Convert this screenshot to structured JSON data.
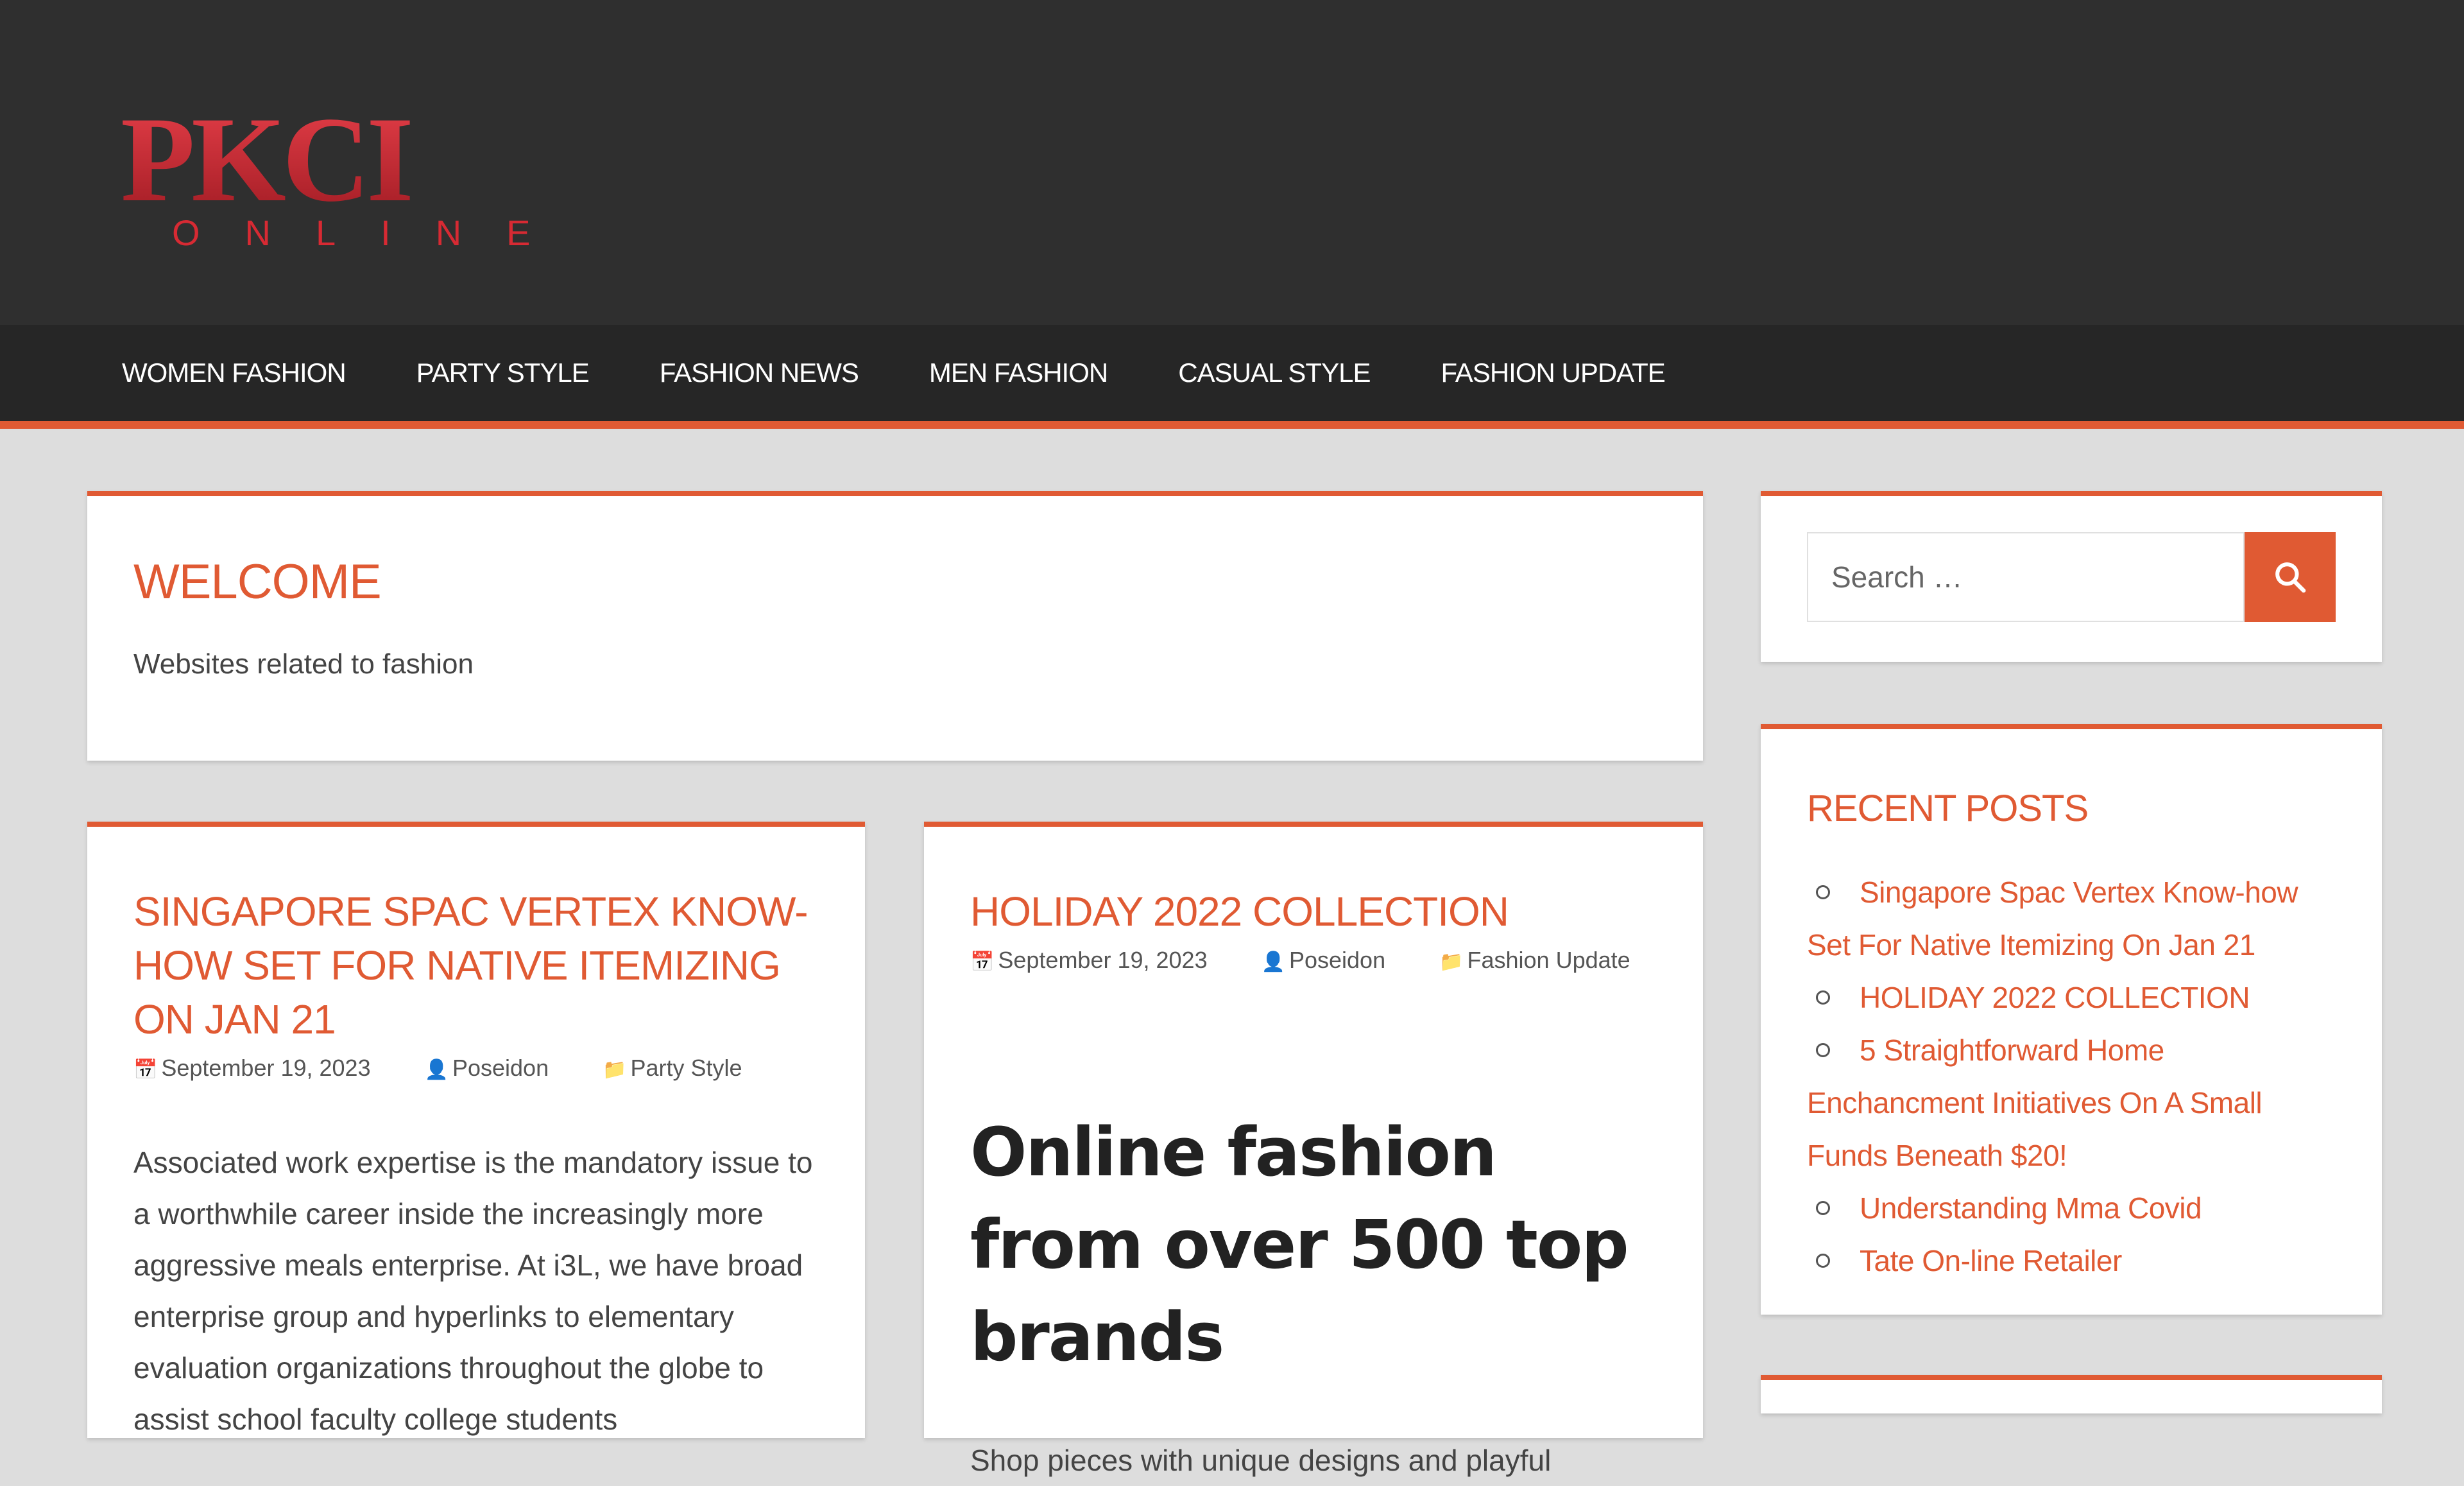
{
  "site": {
    "logo_text": "PKCI",
    "logo_subtext": "ONLINE"
  },
  "nav": {
    "items": [
      {
        "label": "WOMEN FASHION"
      },
      {
        "label": "PARTY STYLE"
      },
      {
        "label": "FASHION NEWS"
      },
      {
        "label": "MEN FASHION"
      },
      {
        "label": "CASUAL STYLE"
      },
      {
        "label": "FASHION UPDATE"
      }
    ]
  },
  "welcome": {
    "title": "WELCOME",
    "description": "Websites related to fashion"
  },
  "posts": [
    {
      "title": "SINGAPORE SPAC VERTEX KNOW-HOW SET FOR NATIVE ITEMIZING ON JAN 21",
      "date": "September 19, 2023",
      "author": "Poseidon",
      "category": "Party Style",
      "excerpt": "Associated work expertise is the mandatory issue to a worthwhile career inside the increasingly more aggressive meals enterprise. At i3L, we have broad enterprise group and hyperlinks to elementary evaluation organizations throughout the globe to assist school faculty college students"
    },
    {
      "title": "HOLIDAY 2022 COLLECTION",
      "date": "September 19, 2023",
      "author": "Poseidon",
      "category": "Fashion Update",
      "headline": "Online fashion from over 500 top brands",
      "excerpt": "Shop pieces with unique designs and playful"
    }
  ],
  "search": {
    "placeholder": "Search …"
  },
  "recent_posts": {
    "title": "RECENT POSTS",
    "items": [
      {
        "label": "Singapore Spac Vertex Know-how Set For Native Itemizing On Jan 21"
      },
      {
        "label": "HOLIDAY 2022 COLLECTION"
      },
      {
        "label": "5 Straightforward Home Enchancment Initiatives On A Small Funds Beneath $20!"
      },
      {
        "label": "Understanding Mma Covid"
      },
      {
        "label": "Tate On-line Retailer"
      }
    ]
  },
  "colors": {
    "accent": "#e05a33",
    "header_bg": "#2f2f2f",
    "nav_bg": "#262626",
    "page_bg": "#dddddd"
  }
}
